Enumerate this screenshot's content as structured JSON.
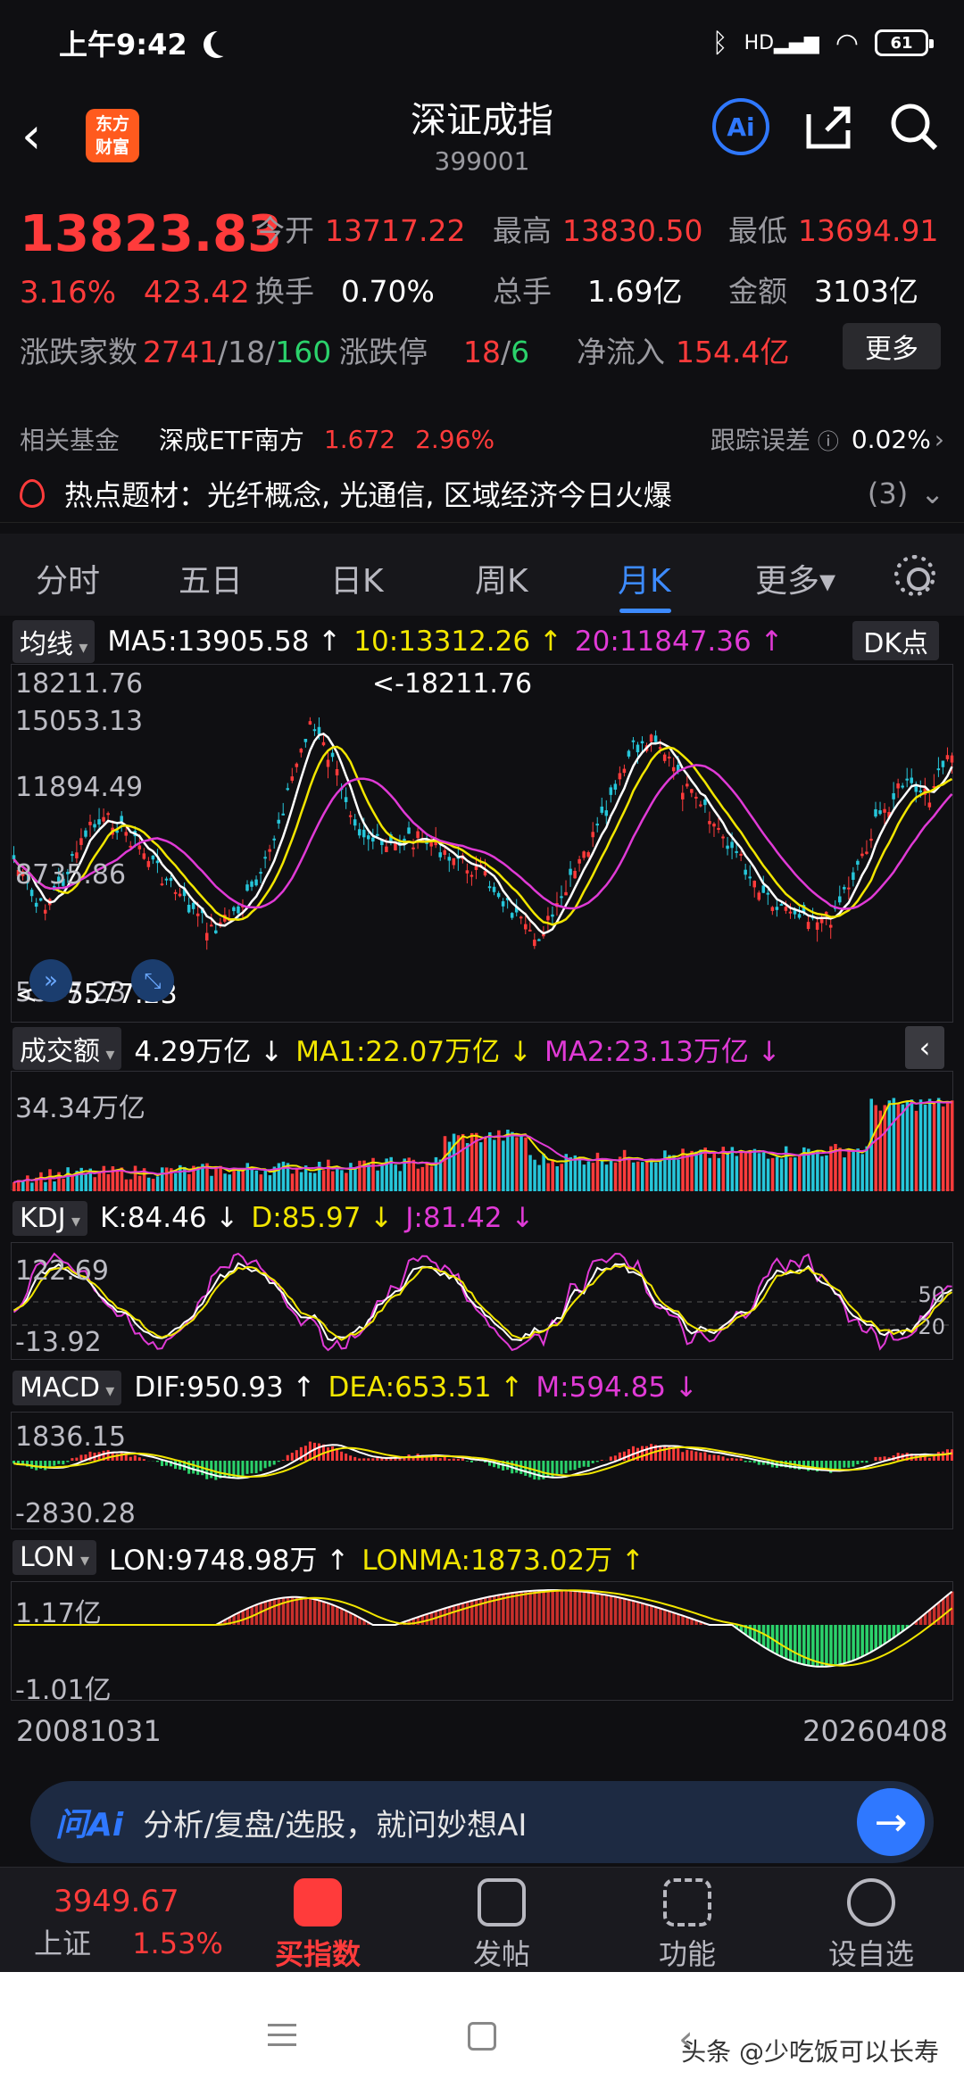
{
  "status": {
    "time": "上午9:42",
    "network": "HD",
    "battery": "61"
  },
  "header": {
    "back_icon": "chevron-left-icon",
    "logo": "东方\n财富",
    "title": "深证成指",
    "code": "399001",
    "ai_label": "Ai"
  },
  "quote": {
    "price": "13823.83",
    "change": "3.16%  423.42",
    "open_label": "今开",
    "open": "13717.22",
    "high_label": "最高",
    "high": "13830.50",
    "low_label": "最低",
    "low": "13694.91",
    "turnover_label": "换手",
    "turnover": "0.70%",
    "volume_label": "总手",
    "volume": "1.69亿",
    "amount_label": "金额",
    "amount": "3103亿",
    "breadth_label": "涨跌家数",
    "breadth_up": "2741",
    "breadth_flat": "/18/",
    "breadth_down": "160",
    "limit_label": "涨跌停",
    "limit_up": "18",
    "limit_sep": "/",
    "limit_down": "6",
    "inflow_label": "净流入",
    "inflow": "154.4亿",
    "more": "更多"
  },
  "fund": {
    "label": "相关基金",
    "name": "深成ETF南方",
    "price": "1.672",
    "change": "2.96%",
    "err_label": "跟踪误差",
    "err": "0.02%"
  },
  "hot": {
    "text": "热点题材：光纤概念, 光通信, 区域经济今日火爆",
    "count": "(3)"
  },
  "tabs": [
    "分时",
    "五日",
    "日K",
    "周K",
    "月K",
    "更多▾"
  ],
  "ma_row": {
    "select": "均线",
    "ma5": "MA5:13905.58 ↑",
    "ma10": "10:13312.26 ↑",
    "ma20": "20:11847.36 ↑",
    "dk": "DK点"
  },
  "kline": {
    "top": "18211.76",
    "mid1": "15053.13",
    "mid2": "11894.49",
    "mid3": "8735.86",
    "bottom": "5577.23",
    "max_note": "<-18211.76",
    "min_note": "<---5577.23"
  },
  "vol_row": {
    "select": "成交额",
    "value": "4.29万亿 ↓",
    "ma1": "MA1:22.07万亿 ↓",
    "ma2": "MA2:23.13万亿 ↓",
    "axis": "34.34万亿"
  },
  "kdj_row": {
    "select": "KDJ",
    "k": "K:84.46 ↓",
    "d": "D:85.97 ↓",
    "j": "J:81.42 ↓",
    "top": "122.69",
    "bottom": "-13.92",
    "r50": "50",
    "r20": "20"
  },
  "macd_row": {
    "select": "MACD",
    "dif": "DIF:950.93 ↑",
    "dea": "DEA:653.51 ↑",
    "m": "M:594.85 ↓",
    "top": "1836.15",
    "bottom": "-2830.28"
  },
  "lon_row": {
    "select": "LON",
    "lon": "LON:9748.98万 ↑",
    "lonma": "LONMA:1873.02万 ↑",
    "top": "1.17亿",
    "bottom": "-1.01亿"
  },
  "dates": {
    "start": "20081031",
    "end": "20260408"
  },
  "askbar": {
    "brand": "问Ai",
    "placeholder": "分析/复盘/选股，就问妙想AI"
  },
  "bottom_nav": {
    "index_price": "3949.67",
    "index_name": "上证",
    "index_change": "1.53%",
    "buy": "买指数",
    "post": "发帖",
    "func": "功能",
    "watch": "设自选"
  },
  "watermark": "头条 @少吃饭可以长寿",
  "colors": {
    "up": "#ff3b3b",
    "down": "#2bd26b",
    "accent": "#2f78ff",
    "ma10": "#f2e600",
    "ma20": "#e03ad6"
  }
}
